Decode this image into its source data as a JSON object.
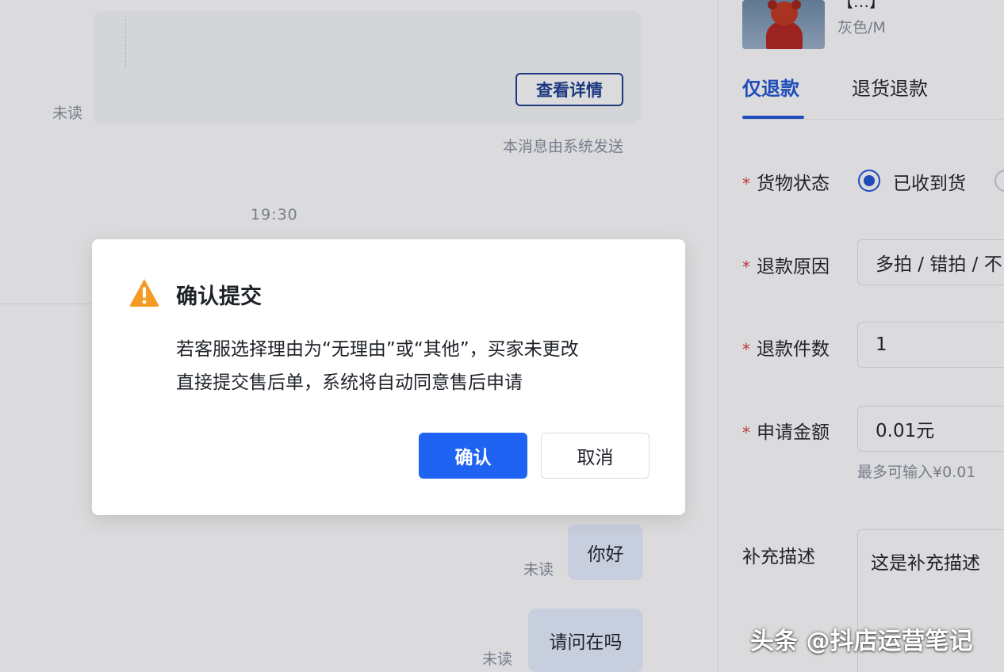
{
  "chat": {
    "detail_button": "查看详情",
    "unread_label": "未读",
    "system_note": "本消息由系统发送",
    "timestamp": "19:30",
    "messages": [
      {
        "text": "你好",
        "status": "未读"
      },
      {
        "text": "请问在吗",
        "status": "未读"
      }
    ]
  },
  "panel": {
    "product": {
      "title_fragment": "【…】",
      "spec": "灰色/M",
      "image": "red-bear-plush-icon"
    },
    "tabs": [
      {
        "label": "仅退款",
        "active": true
      },
      {
        "label": "退货退款",
        "active": false
      }
    ],
    "form": {
      "required_mark": "*",
      "goods_status": {
        "label": "货物状态",
        "selected": "已收到货"
      },
      "refund_reason": {
        "label": "退款原因",
        "value": "多拍 / 错拍 / 不"
      },
      "refund_qty": {
        "label": "退款件数",
        "value": "1"
      },
      "amount": {
        "label": "申请金额",
        "value": "0.01元",
        "hint": "最多可输入¥0.01"
      },
      "description": {
        "label": "补充描述",
        "value": "这是补充描述"
      }
    }
  },
  "dialog": {
    "icon": "warning-triangle-icon",
    "title": "确认提交",
    "body_line1": "若客服选择理由为“无理由”或“其他”，买家未更改",
    "body_line2": "直接提交售后单，系统将自动同意售后申请",
    "confirm": "确认",
    "cancel": "取消"
  },
  "watermark": "头条 @抖店运营笔记",
  "colors": {
    "accent": "#1f63f2",
    "tab_active": "#1f55d6",
    "warning": "#f59a23",
    "required": "#e23b3b",
    "bubble": "#e8f0ff"
  }
}
